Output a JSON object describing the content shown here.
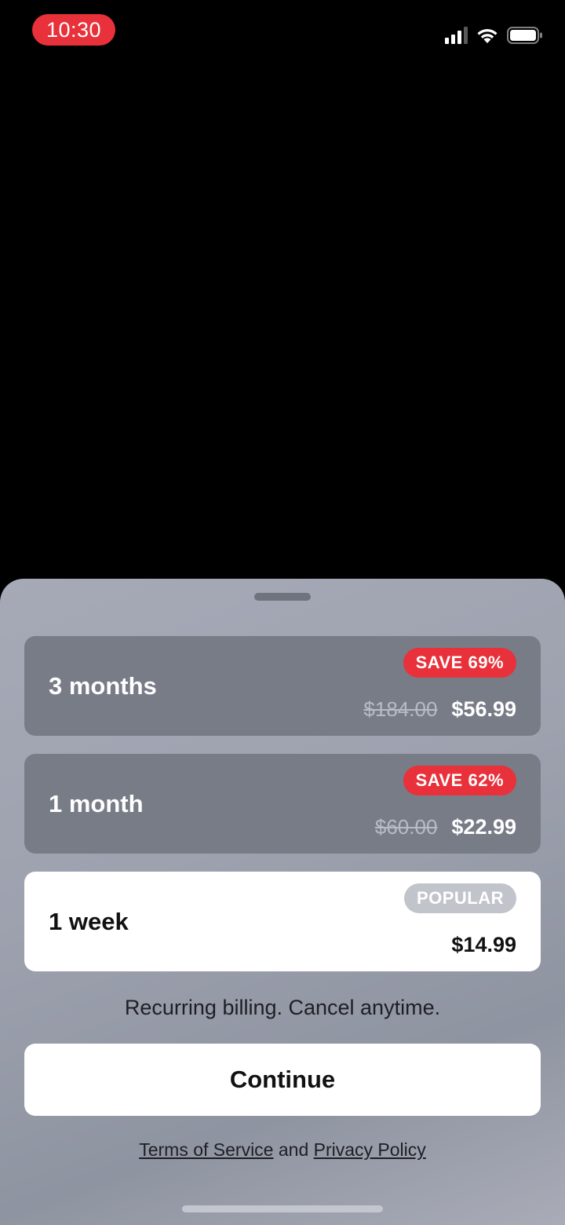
{
  "status_bar": {
    "time": "10:30",
    "icons": [
      "cellular-signal-icon",
      "wifi-icon",
      "battery-icon"
    ],
    "time_pill_color": "#e8313a"
  },
  "plans": [
    {
      "title": "3 months",
      "badge": "SAVE 69%",
      "old_price": "$184.00",
      "price": "$56.99",
      "selected": false
    },
    {
      "title": "1 month",
      "badge": "SAVE 62%",
      "old_price": "$60.00",
      "price": "$22.99",
      "selected": false
    },
    {
      "title": "1 week",
      "badge": "POPULAR",
      "old_price": "",
      "price": "$14.99",
      "selected": true
    }
  ],
  "billing_note": "Recurring billing. Cancel anytime.",
  "continue_label": "Continue",
  "legal": {
    "terms": "Terms of Service",
    "and": "and",
    "privacy": "Privacy Policy"
  },
  "colors": {
    "accent_red": "#e8313a",
    "plan_bg": "#787c87",
    "selected_bg": "#ffffff"
  }
}
